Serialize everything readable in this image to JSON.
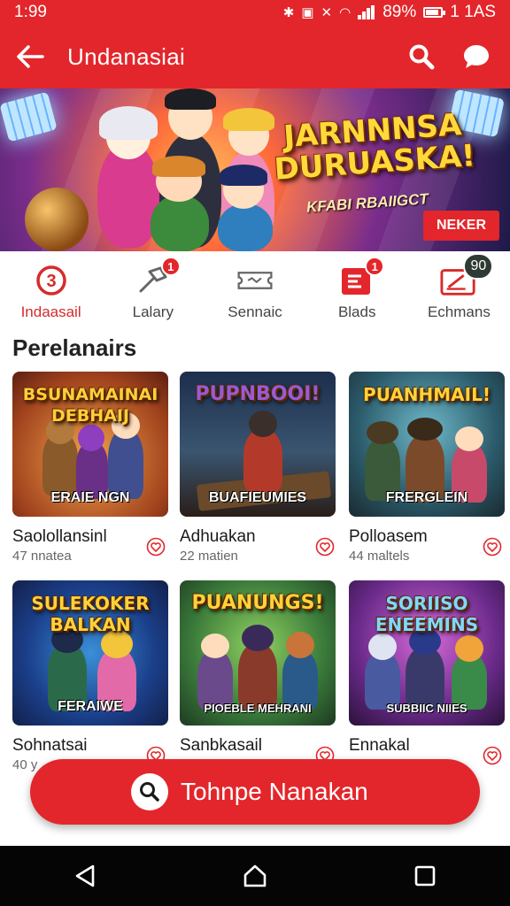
{
  "status_bar": {
    "time": "1:99",
    "battery": "89%",
    "clock_right": "1 1AS"
  },
  "header": {
    "title": "Undanasiai"
  },
  "banner": {
    "title": "JARNNNSA DURUASKA!",
    "subtitle": "KFABI RBAIIGCT",
    "cta": "NEKER"
  },
  "categories": [
    {
      "label": "Indaasail",
      "icon": "circle-three-icon",
      "badge": "",
      "active": true
    },
    {
      "label": "Lalary",
      "icon": "hammer-icon",
      "badge": "1"
    },
    {
      "label": "Sennaic",
      "icon": "ticket-icon",
      "badge": ""
    },
    {
      "label": "Blads",
      "icon": "document-icon",
      "badge": "1"
    },
    {
      "label": "Echmans",
      "icon": "edit-card-icon",
      "badge": "90"
    }
  ],
  "section": {
    "title": "Perelanairs"
  },
  "games": [
    {
      "thumb_title": "BSUNAMAINAI DEBHAIJ",
      "thumb_caption": "ERAIE NGN",
      "name": "Saolollansinl",
      "meta": "47 nnatea"
    },
    {
      "thumb_title": "PUPNBOOI!",
      "thumb_caption": "BUAFIEUMIES",
      "name": "Adhuakan",
      "meta": "22 matien"
    },
    {
      "thumb_title": "PUANHMAIL!",
      "thumb_caption": "FRERGLEIN",
      "name": "Polloasem",
      "meta": "44 maltels"
    },
    {
      "thumb_title": "SULEKOKER BALKAN",
      "thumb_caption": "FERAIWE",
      "name": "Sohnatsai",
      "meta": "40 y"
    },
    {
      "thumb_title": "PUANUNGS!",
      "thumb_caption": "PIOEBLE MEHRANI",
      "name": "Sanbkasail",
      "meta": ""
    },
    {
      "thumb_title": "SORIISO ENEEMINS",
      "thumb_caption": "SUBBIIC NIIES",
      "name": "Ennakal",
      "meta": ""
    }
  ],
  "search_fab": {
    "label": "Tohnpe Nanakan"
  },
  "colors": {
    "primary": "#e3262b",
    "nav": "#050505"
  }
}
